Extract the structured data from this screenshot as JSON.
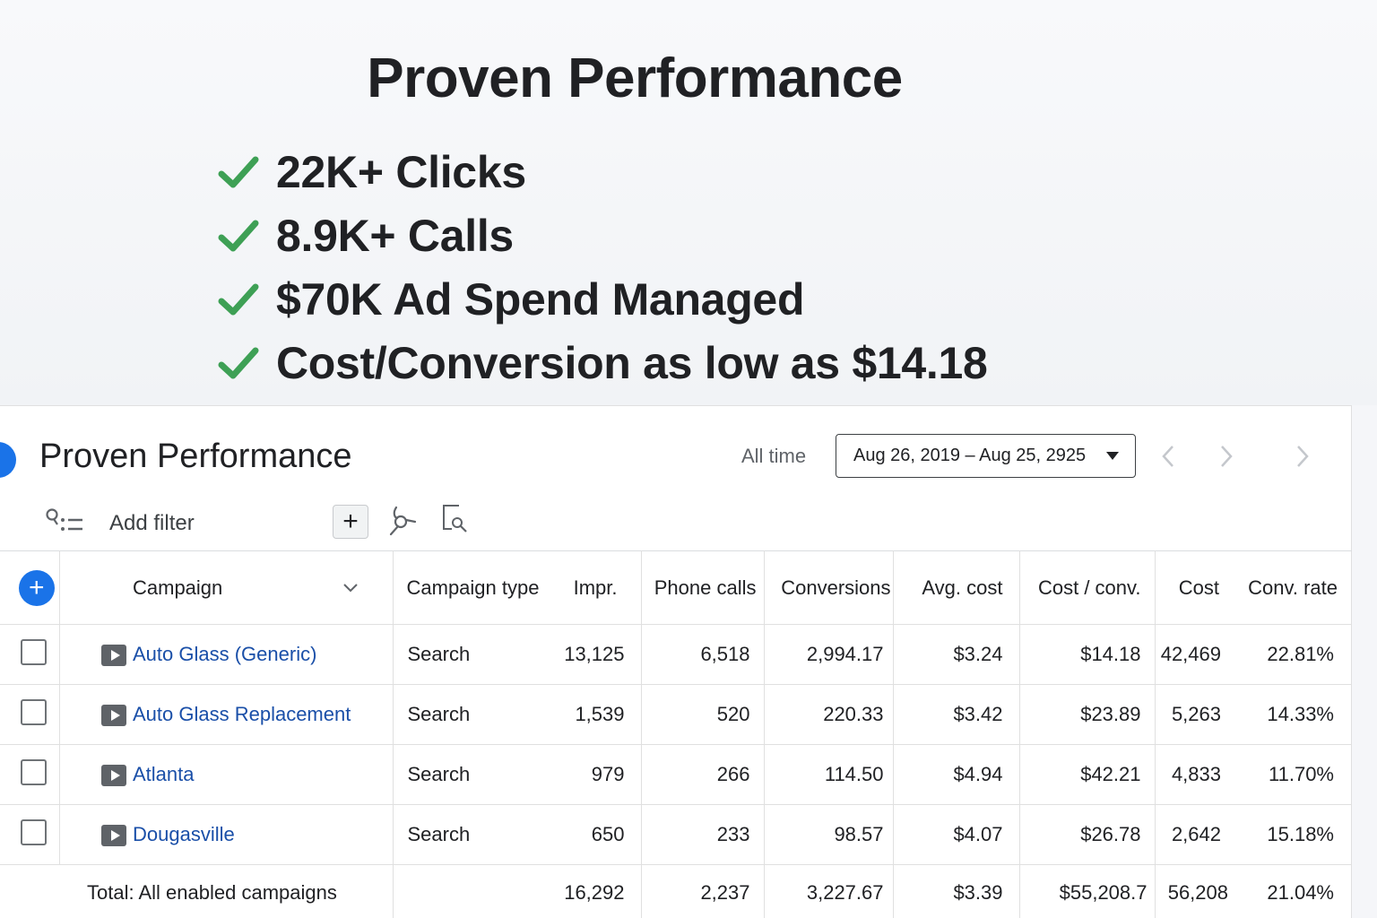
{
  "hero": {
    "title": "Proven Performance",
    "bullets": [
      "22K+ Clicks",
      "8.9K+ Calls",
      "$70K Ad Spend Managed",
      "Cost/Conversion as low as $14.18"
    ],
    "check_color": "#3ea055"
  },
  "panel": {
    "title": "Proven Performance",
    "range_label": "All time",
    "date_range": "Aug 26, 2019 – Aug 25, 2925",
    "add_filter": "Add filter",
    "icons": [
      "filter-icon",
      "plus-icon",
      "segment-icon",
      "search-columns-icon",
      "chevron-left-icon",
      "chevron-right-icon"
    ]
  },
  "table": {
    "headers": {
      "campaign": "Campaign",
      "type": "Campaign type",
      "impr": "Impr.",
      "phone": "Phone calls",
      "conv": "Conversions",
      "avg": "Avg. cost",
      "cpc": "Cost / conv.",
      "cost": "Cost",
      "rate": "Conv. rate"
    },
    "rows": [
      {
        "campaign": "Auto Glass (Generic)",
        "type": "Search",
        "impr": "13,125",
        "phone": "6,518",
        "conv": "2,994.17",
        "avg": "$3.24",
        "cpc": "$14.18",
        "cost": "42,469",
        "rate": "22.81%"
      },
      {
        "campaign": "Auto Glass Replacement",
        "type": "Search",
        "impr": "1,539",
        "phone": "520",
        "conv": "220.33",
        "avg": "$3.42",
        "cpc": "$23.89",
        "cost": "5,263",
        "rate": "14.33%"
      },
      {
        "campaign": "Atlanta",
        "type": "Search",
        "impr": "979",
        "phone": "266",
        "conv": "114.50",
        "avg": "$4.94",
        "cpc": "$42.21",
        "cost": "4,833",
        "rate": "11.70%"
      },
      {
        "campaign": "Dougasville",
        "type": "Search",
        "impr": "650",
        "phone": "233",
        "conv": "98.57",
        "avg": "$4.07",
        "cpc": "$26.78",
        "cost": "2,642",
        "rate": "15.18%"
      }
    ],
    "total": {
      "label": "Total: All enabled campaigns",
      "impr": "16,292",
      "phone": "2,237",
      "conv": "3,227.67",
      "avg": "$3.39",
      "cpc": "$55,208.7",
      "cost": "56,208",
      "rate": "21.04%"
    }
  },
  "colors": {
    "accent": "#1a73e8",
    "link": "#1a4fa8",
    "check": "#3ea055"
  }
}
